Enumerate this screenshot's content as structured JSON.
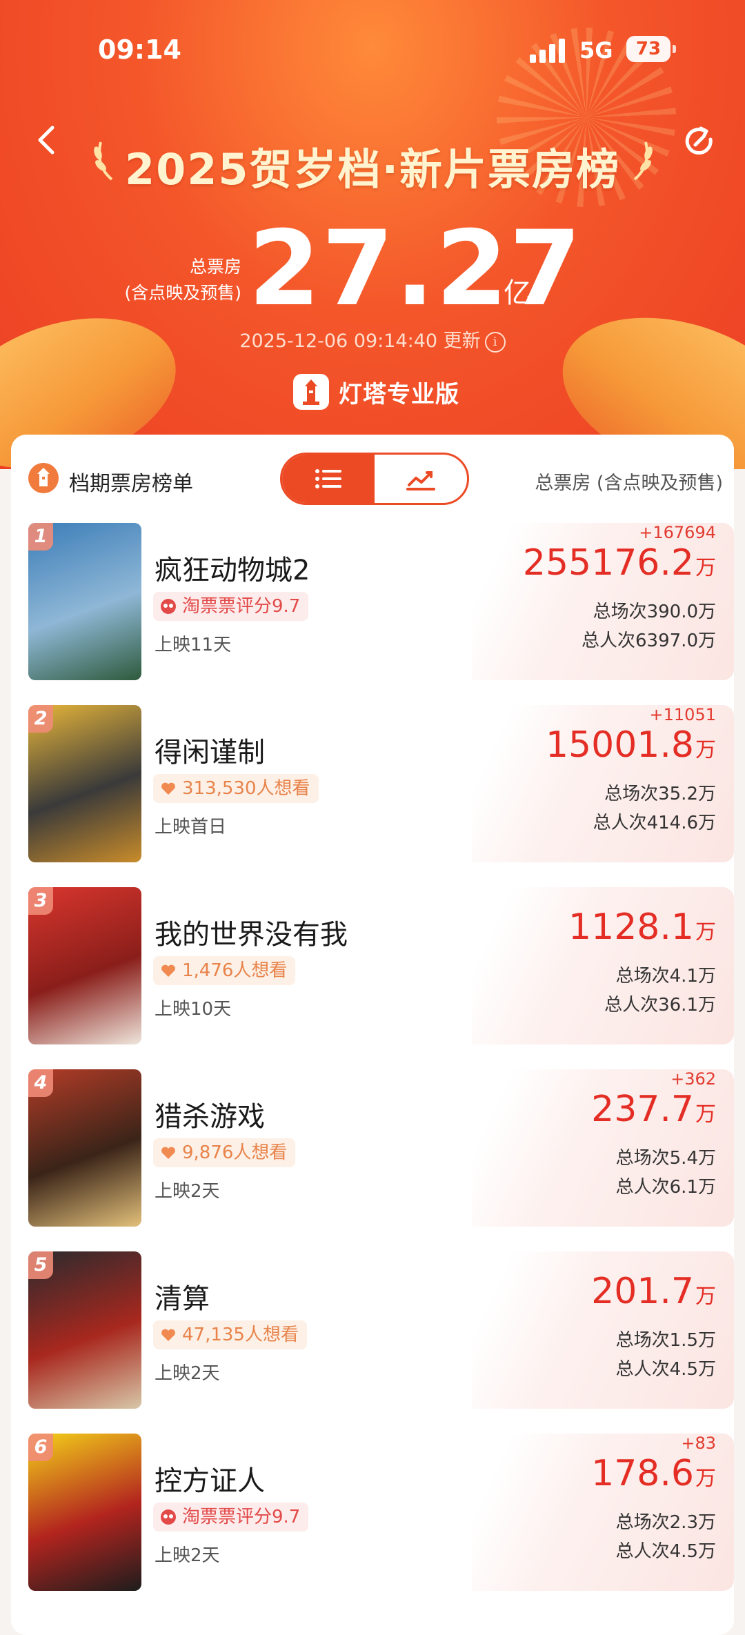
{
  "status_bar": {
    "time": "09:14",
    "network": "5G",
    "battery": "73"
  },
  "header": {
    "title": "2025贺岁档·新片票房榜",
    "total_label_line1": "总票房",
    "total_label_line2": "(含点映及预售)",
    "total_value": "27.27",
    "total_unit": "亿",
    "updated": "2025-12-06 09:14:40 更新",
    "brand": "灯塔专业版"
  },
  "card": {
    "title": "档期票房榜单",
    "right_label": "总票房 (含点映及预售)"
  },
  "movies": [
    {
      "rank": "1",
      "name": "疯狂动物城2",
      "tag_type": "rating",
      "tag": "淘票票评分9.7",
      "days": "上映11天",
      "delta": "+167694",
      "box_office": "255176.2",
      "unit": "万",
      "sessions": "总场次390.0万",
      "people": "总人次6397.0万"
    },
    {
      "rank": "2",
      "name": "得闲谨制",
      "tag_type": "want",
      "tag": "313,530人想看",
      "days": "上映首日",
      "delta": "+11051",
      "box_office": "15001.8",
      "unit": "万",
      "sessions": "总场次35.2万",
      "people": "总人次414.6万"
    },
    {
      "rank": "3",
      "name": "我的世界没有我",
      "tag_type": "want",
      "tag": "1,476人想看",
      "days": "上映10天",
      "delta": "",
      "box_office": "1128.1",
      "unit": "万",
      "sessions": "总场次4.1万",
      "people": "总人次36.1万"
    },
    {
      "rank": "4",
      "name": "猎杀游戏",
      "tag_type": "want",
      "tag": "9,876人想看",
      "days": "上映2天",
      "delta": "+362",
      "box_office": "237.7",
      "unit": "万",
      "sessions": "总场次5.4万",
      "people": "总人次6.1万"
    },
    {
      "rank": "5",
      "name": "清算",
      "tag_type": "want",
      "tag": "47,135人想看",
      "days": "上映2天",
      "delta": "",
      "box_office": "201.7",
      "unit": "万",
      "sessions": "总场次1.5万",
      "people": "总人次4.5万"
    },
    {
      "rank": "6",
      "name": "控方证人",
      "tag_type": "rating",
      "tag": "淘票票评分9.7",
      "days": "上映2天",
      "delta": "+83",
      "box_office": "178.6",
      "unit": "万",
      "sessions": "总场次2.3万",
      "people": "总人次4.5万"
    }
  ],
  "colors": {
    "accent": "#ec4a25",
    "box_office": "#e42d24",
    "hero_bg": "#f4562a"
  },
  "icons": [
    "back-arrow-icon",
    "refresh-icon",
    "info-icon",
    "lighthouse-logo-icon",
    "list-icon",
    "trend-chart-icon",
    "rating-badge-icon",
    "heart-icon"
  ]
}
